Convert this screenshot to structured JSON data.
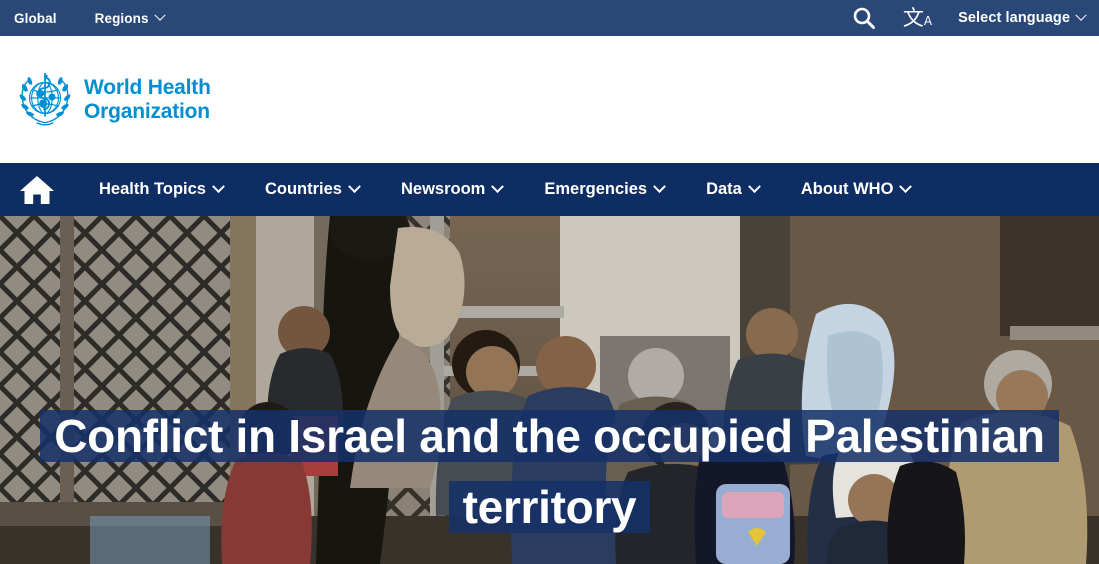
{
  "topbar": {
    "global_label": "Global",
    "regions_label": "Regions",
    "search_icon": "search-icon",
    "translate_icon": "translate-icon",
    "translate_glyph": "文",
    "translate_sub": "A",
    "language_label": "Select language"
  },
  "logo": {
    "emblem_icon": "who-emblem-icon",
    "line1": "World Health",
    "line2": "Organization",
    "color": "#008fd3"
  },
  "mainnav": {
    "home_icon": "home-icon",
    "items": [
      {
        "label": "Health Topics"
      },
      {
        "label": "Countries"
      },
      {
        "label": "Newsroom"
      },
      {
        "label": "Emergencies"
      },
      {
        "label": "Data"
      },
      {
        "label": "About WHO"
      }
    ]
  },
  "hero": {
    "title": "Conflict in Israel and the occupied Palestinian territory",
    "image_alt": "Crowd of people including women and children beside a chain-link fence and building",
    "highlight_color": "#153169"
  },
  "colors": {
    "topbar_bg": "#2a4877",
    "mainnav_bg": "#0e2d63",
    "page_bg": "#ffffff",
    "white": "#ffffff"
  }
}
